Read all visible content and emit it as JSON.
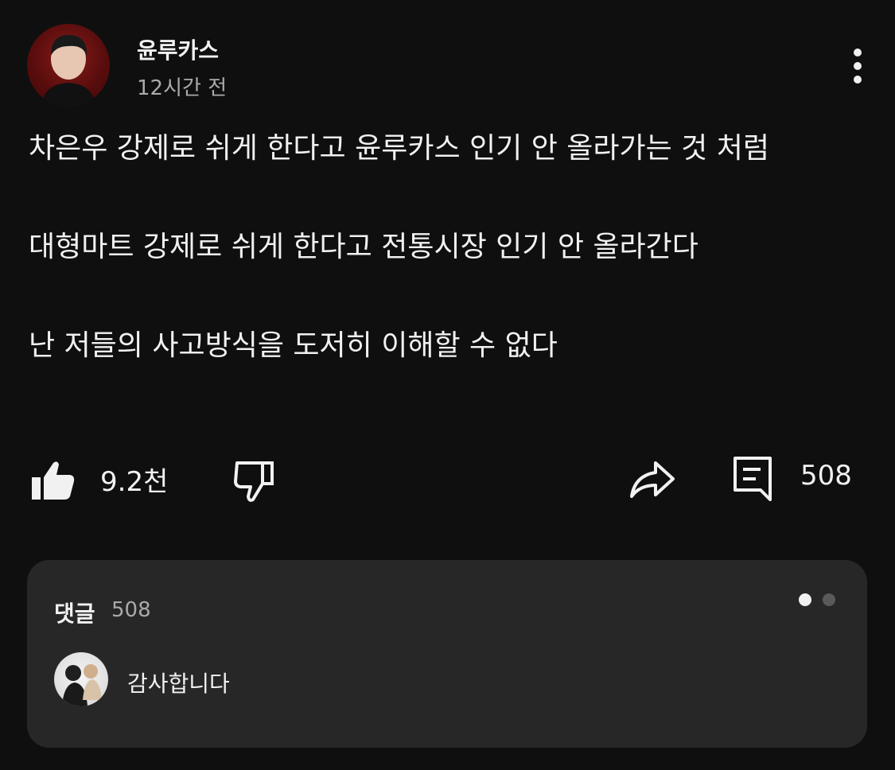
{
  "post": {
    "author": "윤루카스",
    "time": "12시간 전",
    "paragraphs": [
      "차은우 강제로 쉬게 한다고 윤루카스 인기 안 올라가는 것 처럼",
      "대형마트 강제로 쉬게 한다고 전통시장 인기 안 올라간다",
      "난 저들의 사고방식을 도저히 이해할 수 없다"
    ]
  },
  "actions": {
    "like_count": "9.2천",
    "comment_count": "508"
  },
  "comments": {
    "title": "댓글",
    "count": "508",
    "top_comment": "감사합니다"
  },
  "icons": {
    "menu": "more-vertical-icon",
    "like": "thumbs-up-filled-icon",
    "dislike": "thumbs-down-icon",
    "share": "share-arrow-icon",
    "comment": "comment-icon"
  },
  "colors": {
    "background": "#0f0f0f",
    "panel": "#272727",
    "text": "#f1f1f1",
    "secondary_text": "#aaaaaa"
  }
}
